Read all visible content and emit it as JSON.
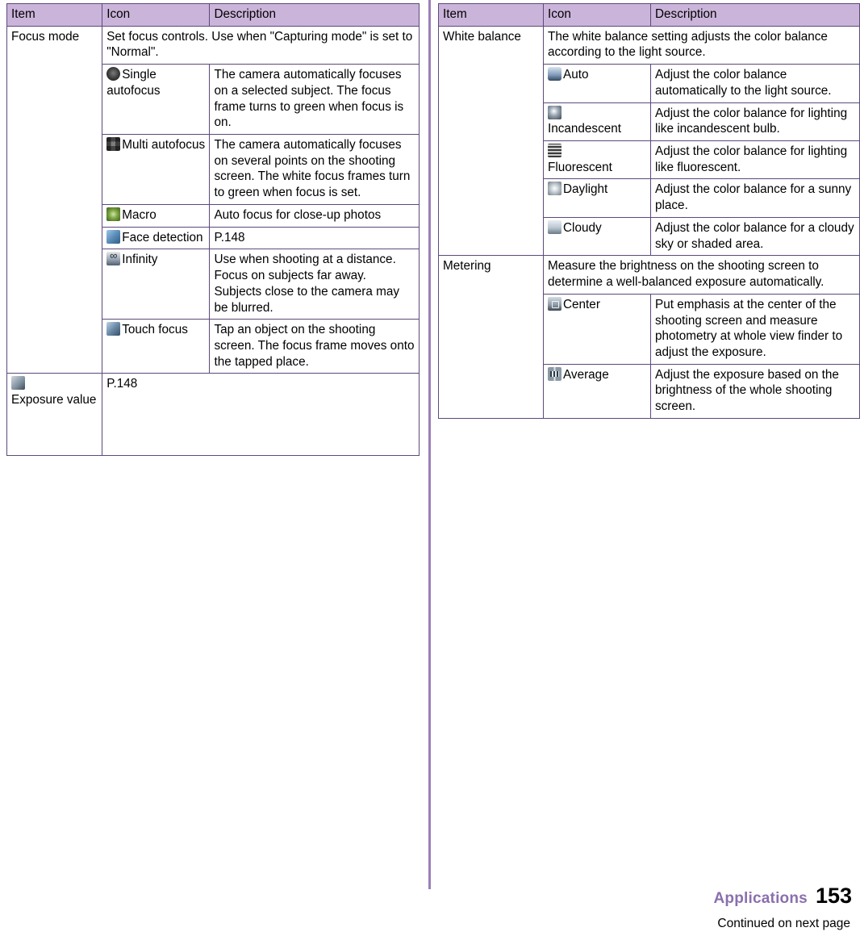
{
  "page": {
    "number": "153",
    "section_label": "Applications",
    "continued": "Continued on next page"
  },
  "left_table": {
    "headers": [
      "Item",
      "Icon",
      "Description"
    ],
    "rows": [
      {
        "type": "group",
        "item": "Focus mode",
        "description": "Set focus controls. Use when \"Capturing mode\" is set to \"Normal\"."
      },
      {
        "type": "sub",
        "icon_name": "single-autofocus-icon",
        "icon_label": "Single autofocus",
        "description": "The camera automatically focuses on a selected subject. The focus frame turns to green when focus is on."
      },
      {
        "type": "sub",
        "icon_name": "multi-autofocus-icon",
        "icon_label": "Multi autofocus",
        "description": "The camera automatically focuses on several points on the shooting screen. The white focus frames turn to green when focus is set."
      },
      {
        "type": "sub",
        "icon_name": "macro-icon",
        "icon_label": "Macro",
        "description": "Auto focus for close-up photos"
      },
      {
        "type": "sub",
        "icon_name": "face-detection-icon",
        "icon_label": "Face detection",
        "description": "P.148"
      },
      {
        "type": "sub",
        "icon_name": "infinity-icon",
        "icon_label": "Infinity",
        "description": "Use when shooting at a distance. Focus on subjects far away. Subjects close to the camera may be blurred."
      },
      {
        "type": "sub",
        "icon_name": "touch-focus-icon",
        "icon_label": "Touch focus",
        "description": "Tap an object on the shooting screen. The focus frame moves onto the tapped place."
      },
      {
        "type": "group_icon_item",
        "icon_name": "exposure-value-icon",
        "item": "Exposure value",
        "description": "P.148"
      }
    ]
  },
  "right_table": {
    "headers": [
      "Item",
      "Icon",
      "Description"
    ],
    "rows": [
      {
        "type": "group",
        "item": "White balance",
        "description": "The white balance setting adjusts the color balance according to the light source."
      },
      {
        "type": "sub",
        "icon_name": "auto-white-balance-icon",
        "icon_label": "Auto",
        "description": "Adjust the color balance automatically to the light source."
      },
      {
        "type": "sub",
        "icon_name": "incandescent-icon",
        "icon_label": "Incandescent",
        "description": "Adjust the color balance for lighting like incandescent bulb."
      },
      {
        "type": "sub",
        "icon_name": "fluorescent-icon",
        "icon_label": "Fluorescent",
        "description": "Adjust the color balance for lighting like fluorescent."
      },
      {
        "type": "sub",
        "icon_name": "daylight-icon",
        "icon_label": "Daylight",
        "description": "Adjust the color balance for a sunny place."
      },
      {
        "type": "sub",
        "icon_name": "cloudy-icon",
        "icon_label": "Cloudy",
        "description": "Adjust the color balance for a cloudy sky or shaded area."
      },
      {
        "type": "group",
        "item": "Metering",
        "description": "Measure the brightness on the shooting screen to determine a well-balanced exposure automatically."
      },
      {
        "type": "sub",
        "icon_name": "center-metering-icon",
        "icon_label": "Center",
        "description": "Put emphasis at the center of the shooting screen and measure photometry at whole view finder to adjust the exposure."
      },
      {
        "type": "sub",
        "icon_name": "average-metering-icon",
        "icon_label": "Average",
        "description": "Adjust the exposure based on the brightness of the whole shooting screen."
      }
    ]
  },
  "colors": {
    "header_bg": "#cbb4da",
    "border": "#5b4a7a",
    "accent": "#8a6fae"
  }
}
